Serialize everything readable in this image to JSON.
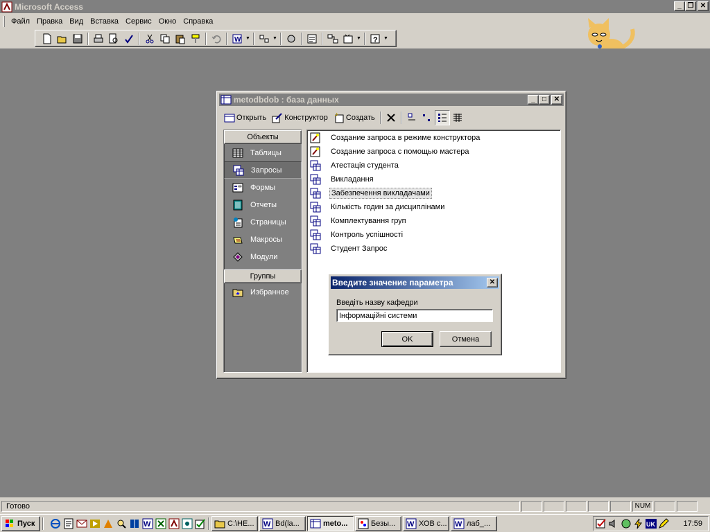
{
  "app": {
    "title": "Microsoft Access",
    "caption_buttons": [
      "minimize-icon",
      "restore-icon",
      "close-icon"
    ]
  },
  "menu": [
    {
      "label": "Файл"
    },
    {
      "label": "Правка"
    },
    {
      "label": "Вид"
    },
    {
      "label": "Вставка"
    },
    {
      "label": "Сервис"
    },
    {
      "label": "Окно"
    },
    {
      "label": "Справка"
    }
  ],
  "toolbar": {
    "icons": [
      "new-icon",
      "open-icon",
      "save-icon",
      "print-icon",
      "print-preview-icon",
      "spelling-icon",
      "cut-icon",
      "copy-icon",
      "paste-icon",
      "format-painter-icon",
      "undo-icon",
      "office-links-icon",
      "analyze-icon",
      "code-icon",
      "properties-icon",
      "relationships-icon",
      "new-object-icon",
      "help-icon"
    ]
  },
  "db_window": {
    "title": "metodbdob : база данных",
    "toolbar": {
      "open_label": "Открыть",
      "design_label": "Конструктор",
      "create_label": "Создать"
    },
    "objects_header": "Объекты",
    "objects": [
      {
        "label": "Таблицы",
        "icon": "table-icon"
      },
      {
        "label": "Запросы",
        "icon": "query-icon",
        "selected": true
      },
      {
        "label": "Формы",
        "icon": "form-icon"
      },
      {
        "label": "Отчеты",
        "icon": "report-icon"
      },
      {
        "label": "Страницы",
        "icon": "page-icon"
      },
      {
        "label": "Макросы",
        "icon": "macro-icon"
      },
      {
        "label": "Модули",
        "icon": "module-icon"
      }
    ],
    "groups_header": "Группы",
    "groups": [
      {
        "label": "Избранное",
        "icon": "favorites-folder-icon"
      }
    ],
    "items": [
      {
        "label": "Создание запроса в режиме конструктора",
        "icon": "wizard-icon"
      },
      {
        "label": "Создание запроса с помощью мастера",
        "icon": "wizard-icon"
      },
      {
        "label": "Атестація студента",
        "icon": "query-icon"
      },
      {
        "label": "Викладання",
        "icon": "query-icon"
      },
      {
        "label": "Забезпечення викладачами",
        "icon": "query-icon",
        "focused": true
      },
      {
        "label": "Кількість годин за дисциплінами",
        "icon": "query-icon"
      },
      {
        "label": "Комплектування груп",
        "icon": "query-icon"
      },
      {
        "label": "Контроль успішності",
        "icon": "query-icon"
      },
      {
        "label": "Студент Запрос",
        "icon": "query-icon"
      }
    ]
  },
  "param_dialog": {
    "title": "Введите значение параметра",
    "prompt": "Введіть назву кафедри",
    "value": "Інформаційні системи",
    "ok_label": "OK",
    "cancel_label": "Отмена"
  },
  "statusbar": {
    "text": "Готово",
    "num_label": "NUM"
  },
  "taskbar": {
    "start_label": "Пуск",
    "tasks": [
      {
        "label": "C:\\НЕ...",
        "icon": "folder-icon"
      },
      {
        "label": "Bd(la...",
        "icon": "word-icon"
      },
      {
        "label": "meto...",
        "icon": "access-db-icon",
        "active": true
      },
      {
        "label": "Безы...",
        "icon": "paint-icon"
      },
      {
        "label": "ХОВ с...",
        "icon": "word-icon"
      },
      {
        "label": "лаб_...",
        "icon": "word-icon"
      }
    ],
    "tray_lang": "UK",
    "clock": "17:59"
  }
}
